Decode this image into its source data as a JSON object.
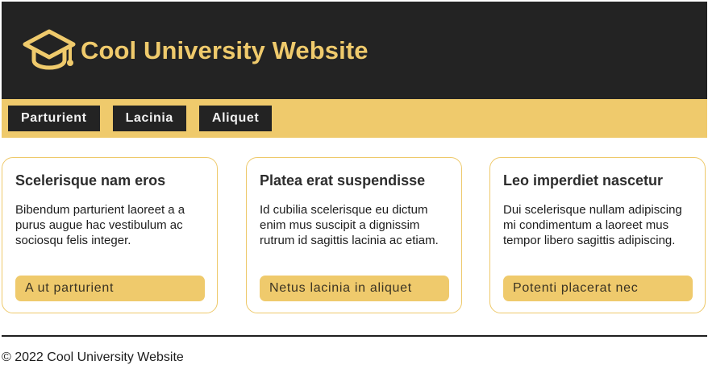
{
  "colors": {
    "accent": "#efca6c",
    "header_bg": "#232323",
    "nav_button_bg": "#232323",
    "nav_button_text": "#f2f2f2",
    "card_border": "#eec96a",
    "card_button_bg": "#efca6c"
  },
  "header": {
    "logo_icon": "graduation-cap-icon",
    "title": "Cool University Website"
  },
  "nav": {
    "items": [
      {
        "label": "Parturient"
      },
      {
        "label": "Lacinia"
      },
      {
        "label": "Aliquet"
      }
    ]
  },
  "cards": [
    {
      "title": "Scelerisque nam eros",
      "text": "Bibendum parturient laoreet a a purus augue hac vestibulum ac sociosqu felis integer.",
      "button": "A ut parturient"
    },
    {
      "title": "Platea erat suspendisse",
      "text": "Id cubilia scelerisque eu dictum enim mus suscipit a dignissim rutrum id sagittis lacinia ac etiam.",
      "button": "Netus lacinia in aliquet"
    },
    {
      "title": "Leo imperdiet nascetur",
      "text": "Dui scelerisque nullam adipiscing mi condimentum a laoreet mus tempor libero sagittis adipiscing.",
      "button": "Potenti placerat nec"
    }
  ],
  "footer": {
    "text": "© 2022 Cool University Website"
  }
}
